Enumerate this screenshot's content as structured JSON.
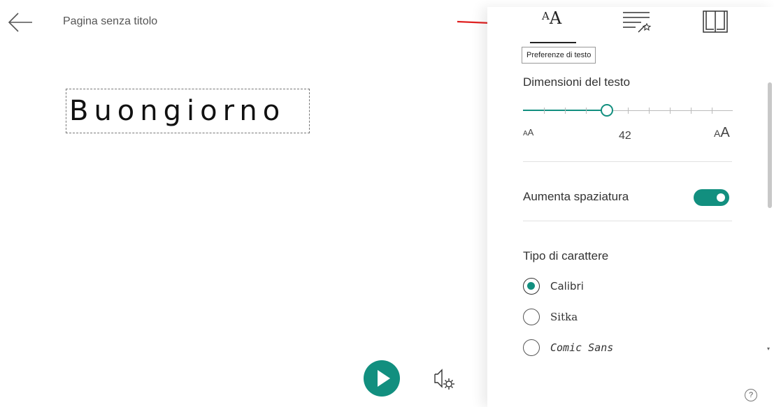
{
  "header": {
    "back_icon": "arrow-left-icon",
    "title": "Pagina senza titolo"
  },
  "reader": {
    "word": "Buongiorno"
  },
  "playback": {
    "play_icon": "play-icon",
    "voice_settings_icon": "voice-settings-icon"
  },
  "panel": {
    "tabs": [
      {
        "id": "text-preferences",
        "icon": "text-size-icon",
        "selected": true
      },
      {
        "id": "grammar-options",
        "icon": "grammar-options-icon",
        "selected": false
      },
      {
        "id": "reading-preferences",
        "icon": "book-icon",
        "selected": false
      }
    ],
    "tooltip": "Preferenze di testo",
    "text_size": {
      "title": "Dimensioni del testo",
      "value": "42",
      "level_fraction": 0.4,
      "small_glyph": "AA",
      "big_glyph": "AA"
    },
    "spacing": {
      "label": "Aumenta spaziatura",
      "on": true
    },
    "font": {
      "title": "Tipo di carattere",
      "options": [
        {
          "label": "Calibri",
          "checked": true
        },
        {
          "label": "Sitka",
          "checked": false
        },
        {
          "label": "Comic Sans",
          "checked": false
        }
      ]
    },
    "help_label": "?"
  },
  "colors": {
    "accent": "#128f7f",
    "annotation_arrow": "#e02020"
  }
}
